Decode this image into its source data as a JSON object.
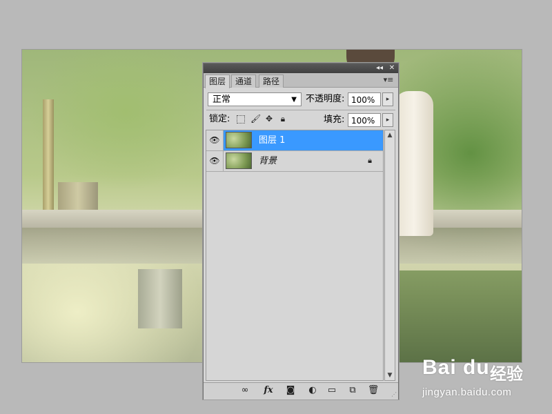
{
  "panel": {
    "tabs": [
      {
        "label": "图层",
        "active": true
      },
      {
        "label": "通道",
        "active": false
      },
      {
        "label": "路径",
        "active": false
      }
    ],
    "titlebar": {
      "collapse_glyph": "◂◂",
      "close_glyph": "✕"
    },
    "menu_glyph": "▾≡",
    "blend_mode": {
      "value": "正常",
      "arrow": "▼"
    },
    "opacity": {
      "label": "不透明度:",
      "value": "100%"
    },
    "lock": {
      "label": "锁定:"
    },
    "fill": {
      "label": "填充:",
      "value": "100%"
    },
    "stepper_glyph": "▸",
    "layers": [
      {
        "name": "图层 1",
        "selected": true,
        "visible": true,
        "locked": false
      },
      {
        "name": "背景",
        "selected": false,
        "visible": true,
        "locked": true
      }
    ],
    "scroll": {
      "up": "▲",
      "down": "▼"
    },
    "footer_icons": [
      "link-icon",
      "fx-icon",
      "mask-icon",
      "adjustment-icon",
      "group-folder-icon",
      "new-layer-icon",
      "trash-icon"
    ],
    "footer_glyphs": {
      "link": "∞",
      "fx": "fx",
      "mask": "◙",
      "adjust": "◐",
      "group": "▭",
      "new": "⧉",
      "trash": "🗑"
    }
  },
  "colors": {
    "selection": "#3a99ff",
    "panel_bg": "#d6d6d6",
    "workspace_bg": "#b9b9b9"
  },
  "watermark": {
    "logo": "Bai du",
    "cn": "经验",
    "url": "jingyan.baidu.com"
  }
}
